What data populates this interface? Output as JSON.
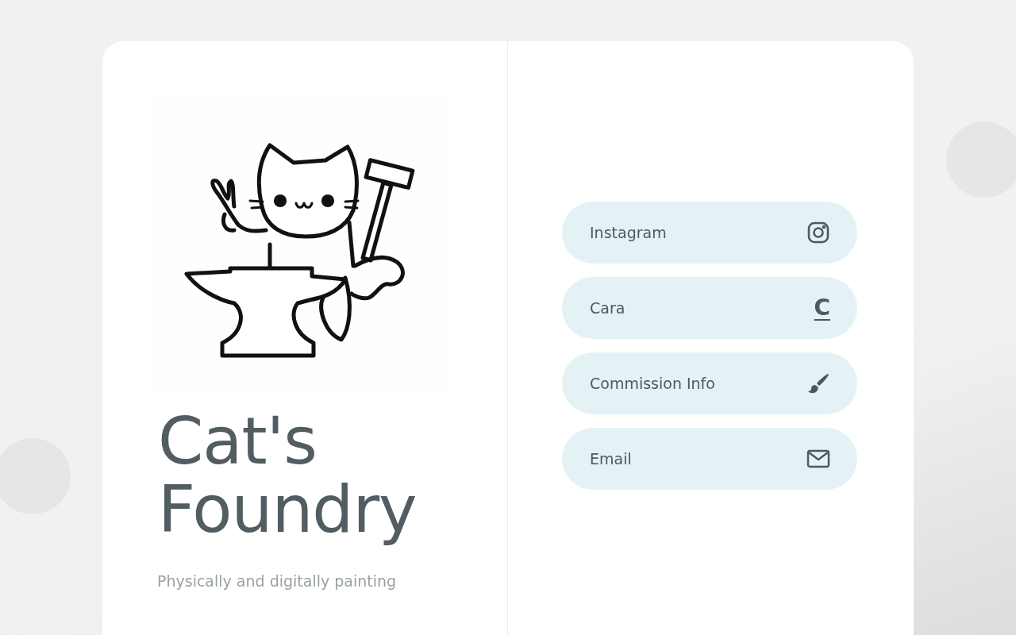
{
  "profile": {
    "title": "Cat's Foundry",
    "tagline": "Physically and digitally painting"
  },
  "links": [
    {
      "label": "Instagram",
      "kind": "instagram"
    },
    {
      "label": "Cara",
      "kind": "letter",
      "icon_text": "C"
    },
    {
      "label": "Commission Info",
      "kind": "brush"
    },
    {
      "label": "Email",
      "kind": "email"
    }
  ]
}
